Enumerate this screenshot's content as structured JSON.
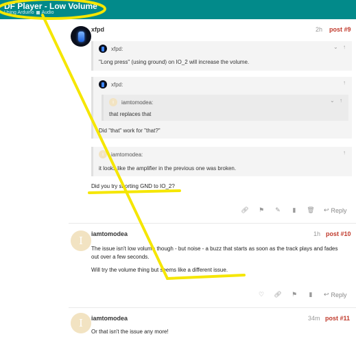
{
  "header": {
    "title": "DF Player - Low Volume",
    "crumb1": "Using Arduino",
    "crumb2": "Audio"
  },
  "posts": [
    {
      "username": "xfpd",
      "time": "2h",
      "number": "post #9",
      "quotes": [
        {
          "author": "xfpd:",
          "text": "\"Long press\" (using ground) on IO_2 will increase the volume."
        },
        {
          "author": "xfpd:",
          "nested_author": "iamtomodea:",
          "nested_text": "that replaces that",
          "text": "Did \"that\" work for \"that?\""
        },
        {
          "author": "iamtomodea:",
          "text": "it looks like the amplifier in the previous one was broken."
        }
      ],
      "body": "Did you try shorting GND to IO_2?",
      "reply": "Reply"
    },
    {
      "username": "iamtomodea",
      "avatar_letter": "I",
      "time": "1h",
      "number": "post #10",
      "body1": "The issue isn't low volume though - but noise - a buzz that starts as soon as the track plays and fades out over a few seconds.",
      "body2": "Will try the volume thing but seems like a different issue.",
      "reply": "Reply"
    },
    {
      "username": "iamtomodea",
      "avatar_letter": "I",
      "time": "34m",
      "number": "post #11",
      "body": "Or that isn't the issue any more!"
    }
  ],
  "colors": {
    "header": "#028a8a",
    "highlight": "#f5e600",
    "post_number": "#c0392b"
  }
}
